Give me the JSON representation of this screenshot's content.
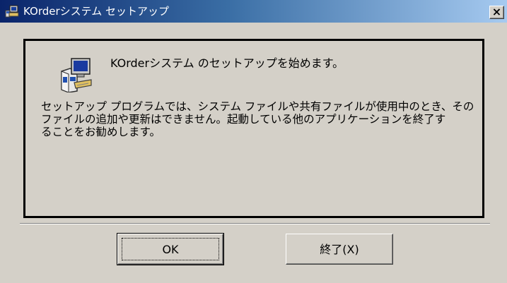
{
  "window": {
    "title": "KOrderシステム セットアップ",
    "close_label": "×"
  },
  "dialog": {
    "heading": "KOrderシステム のセットアップを始めます。",
    "message_lines": [
      "セットアップ プログラムでは、システム ファイルや共有ファイルが使用中のとき、その",
      "ファイルの追加や更新はできません。起動している他のアプリケーションを終了す",
      "ることをお勧めします。"
    ]
  },
  "buttons": {
    "ok_label": "OK",
    "exit_label": "終了(X)"
  },
  "colors": {
    "dialog_face": "#d4d0c8",
    "titlebar_start": "#0a246a",
    "titlebar_end": "#a6caf0"
  },
  "icons": {
    "title_icon": "setup-computer-icon",
    "panel_icon": "setup-computer-box-icon"
  }
}
